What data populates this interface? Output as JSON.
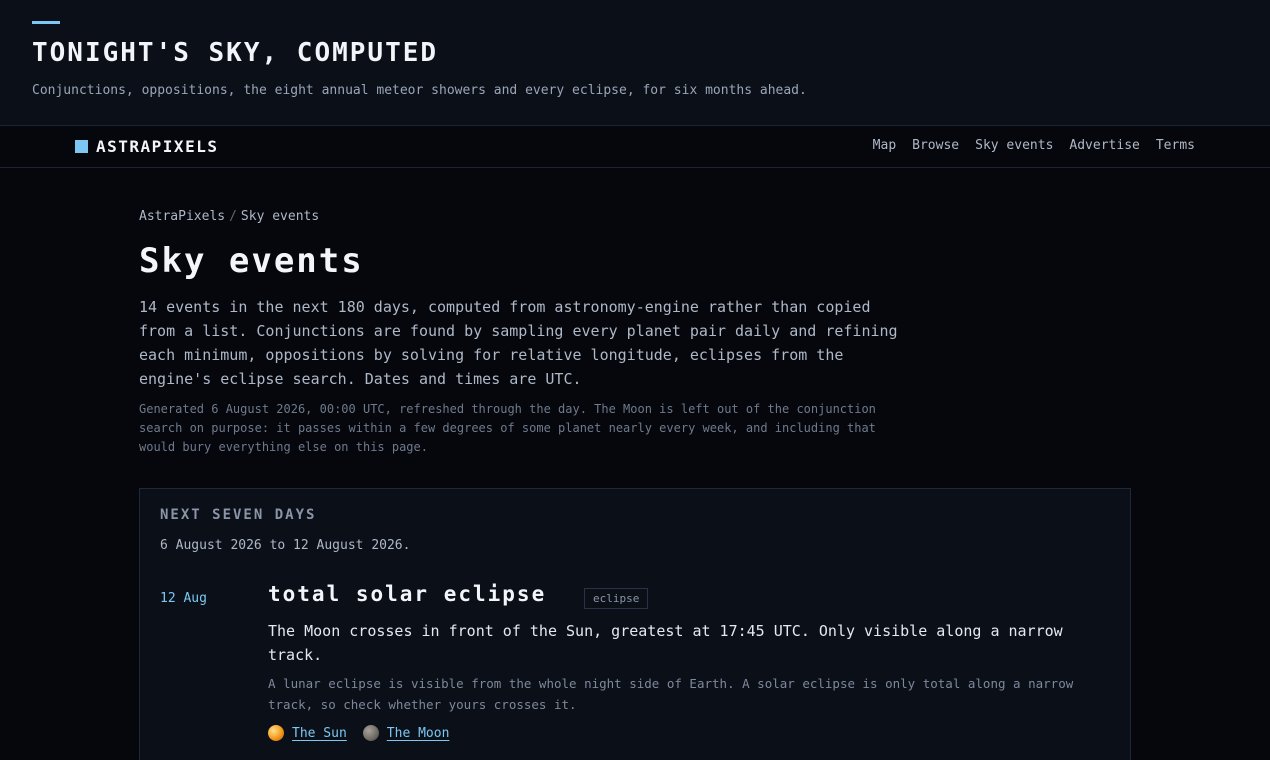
{
  "banner": {
    "title": "TONIGHT'S SKY, COMPUTED",
    "subtitle": "Conjunctions, oppositions, the eight annual meteor showers and every eclipse, for six months ahead."
  },
  "nav": {
    "brand": "ASTRAPIXELS",
    "links": [
      "Map",
      "Browse",
      "Sky events",
      "Advertise",
      "Terms"
    ]
  },
  "breadcrumb": {
    "root": "AstraPixels",
    "separator": "/",
    "current": "Sky events"
  },
  "page": {
    "title": "Sky events",
    "intro": "14 events in the next 180 days, computed from astronomy-engine rather than copied from a list. Conjunctions are found by sampling every planet pair daily and refining each minimum, oppositions by solving for relative longitude, eclipses from the engine's eclipse search. Dates and times are UTC.",
    "note": "Generated 6 August 2026, 00:00 UTC, refreshed through the day. The Moon is left out of the conjunction search on purpose: it passes within a few degrees of some planet nearly every week, and including that would bury everything else on this page."
  },
  "next_seven_days": {
    "title": "NEXT SEVEN DAYS",
    "range": "6 August 2026 to 12 August 2026.",
    "events": [
      {
        "date": "12 Aug",
        "title": "total solar eclipse",
        "tag": "eclipse",
        "description": "The Moon crosses in front of the Sun, greatest at 17:45 UTC. Only visible along a narrow track.",
        "note": "A lunar eclipse is visible from the whole night side of Earth. A solar eclipse is only total along a narrow track, so check whether yours crosses it.",
        "bodies": [
          {
            "name": "The Sun",
            "icon": "sun-icon"
          },
          {
            "name": "The Moon",
            "icon": "moon-icon"
          }
        ]
      }
    ]
  },
  "colors": {
    "accent": "#7cc8f2",
    "background": "#05070c",
    "panel": "#0b0f18"
  }
}
